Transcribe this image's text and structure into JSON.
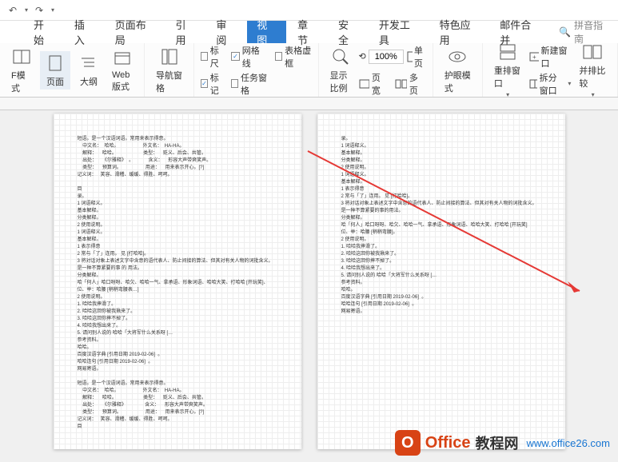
{
  "qat": {
    "undo": "↶",
    "redo": "↷"
  },
  "menus": {
    "items": [
      "开始",
      "插入",
      "页面布局",
      "引用",
      "审阅",
      "视图",
      "章节",
      "安全",
      "开发工具",
      "特色应用",
      "邮件合并"
    ],
    "active_index": 5
  },
  "search": {
    "placeholder": "拼音指南",
    "icon": "🔍"
  },
  "ribbon": {
    "view_modes": {
      "read": "F模式",
      "page": "页面",
      "outline": "大纲",
      "web": "Web版式"
    },
    "nav_pane": "导航窗格",
    "checks": {
      "ruler": "标尺",
      "grid": "网格线",
      "table_virtual": "表格虚框",
      "mark": "标记",
      "task_pane": "任务窗格"
    },
    "zoom": {
      "show_scale": "显示比例",
      "value": "100%",
      "one_page": "单页",
      "page_width": "页宽",
      "multi_page": "多页"
    },
    "eye_mode": "护眼模式",
    "window": {
      "rearrange": "重排窗口",
      "new_window": "新建窗口",
      "split": "拆分窗口",
      "side_by_side": "并排比较"
    }
  },
  "page1_text": "短语。是一个汉语词语。常用来表示得意。\n    中文名：  哈哈。                  外文名：  HA-HA。\n    解释：    哈哈。                    类型：    贬义、后会、共管。\n    出处：    《尔雅释》  。           含义：    形容大声带爽笑声。\n    类型：    预算词。                  用途：    用来表示开心。[?]\n记义词：   笑容、滑稽、缓缓、得胜、呵呵。\n\n目\n录。\n1 词语释义。\n基本解释。\n分类解释。\n2 使用说明。\n1 词语释义。\n基本解释。\n1 表示得意\n2 常与「了」连用。 见 [打哈哈]。\n3 将对话对象上表述文字中含意的语代表人、防止间接的算法、但其对有关人物的词批含义。\n是一种不算紧要的事 的 用法。\n分类解释。\n哈「何人」哈口呀呀、哈欠、哈哈一气、拿承语、形象词语、哈哈大笑、打哈哈 [开玩笑]、\n位、举：哈腰 [稍稍弯腰表…]\n2 使用说明。\n1. 哈哈我摔滑了。\n2. 哈哈这回你被我揪来了。\n3. 哈哈这回你摔不掉了。\n4. 哈哈我想出来了。\n5. 请问别人说的 哈哈「大将军什么关系呀 […\n参考资料。\n哈哈。\n百度汉语字典 [引用日期 2019-02-06]  。\n哈哈连句 [引用日期 2019-02-06]  。\n网易寄语。\n\n短语。是一个汉语词语。常用来表示得意。\n    中文名：  哈哈。                  外文名：  HA-HA。\n    解释：    哈哈。                    类型：    贬义、后会、共管。\n    出处：    《尔雅释》              含义：    形容大声带爽笑声。\n    类型：    预算词。                  用途：    用来表示开心。[?]\n记义词：   笑容、滑稽、缓缓、得胜、呵呵。\n目",
  "page2_text": "录。\n1 词语释义。\n基本解释。\n分类解释。\n2 使用说明。\n1 词语释义。\n基本解释。\n1 表示得意\n2 常与「了」连用。 见 [打哈哈]。\n3 将对话对象上表述文字中含意的语代表人、防止间接的算法、但其对有关人物的词批含义。\n是一种不算紧要的事的用法。\n分类解释。\n哈「何人」哈口呀呀、哈欠、哈哈一气、拿承语、形象词语、哈哈大笑、打哈哈 [开玩笑]\n位、举：哈腰 [稍稍弯腰]。\n2 使用说明。\n1. 哈哈我摔滑了。\n2. 哈哈这回你被我揪来了。\n3. 哈哈这回你摔不掉了。\n4. 哈哈我想出来了。\n5. 请问别人说的 哈哈「大将军什么关系呀 […\n参考资料。\n哈哈。\n百度汉语字典 [引用日期 2019-02-06]  。\n哈哈连句 [引用日期 2019-02-06]  。\n网易寄语。",
  "watermark": {
    "brand1": "Office",
    "brand2": "教程网",
    "url": "www.office26.com"
  }
}
